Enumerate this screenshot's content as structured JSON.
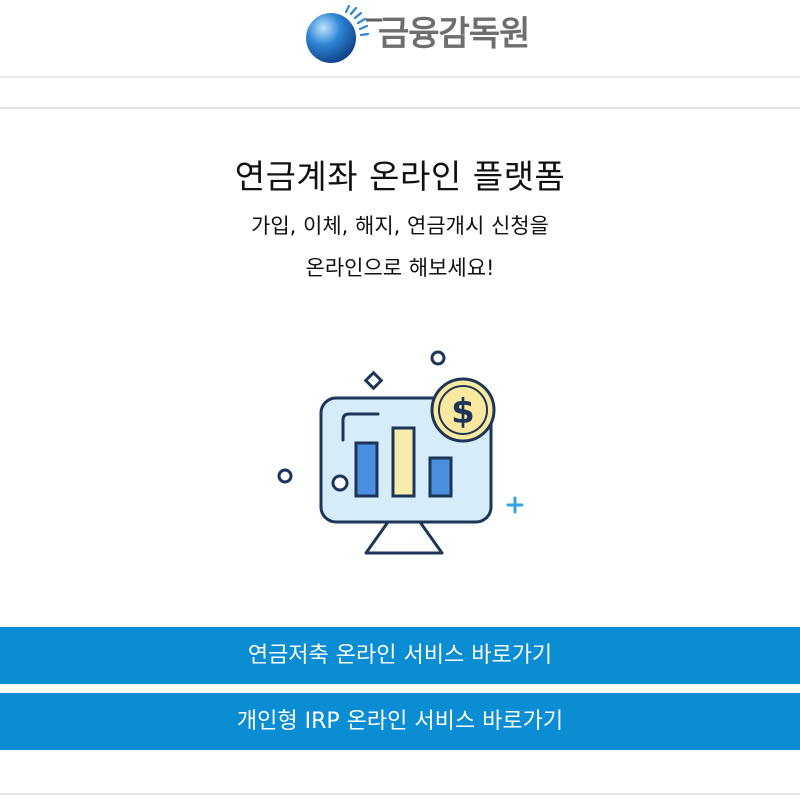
{
  "header": {
    "logo_text": "금융감독원",
    "logo_icon": "fss-globe-logo"
  },
  "hero": {
    "title": "연금계좌 온라인 플랫폼",
    "subtitle_line1": "가입, 이체, 해지, 연금개시 신청을",
    "subtitle_line2": "온라인으로 해보세요!",
    "illustration_icon": "monitor-bar-chart-dollar-icon",
    "dollar_symbol": "$"
  },
  "buttons": {
    "pension_savings_label": "연금저축 온라인 서비스 바로가기",
    "irp_label": "개인형 IRP 온라인 서비스 바로가기"
  },
  "colors": {
    "button_bg": "#0b8dd3",
    "button_text": "#ffffff",
    "logo_blue": "#1f6fbf",
    "logo_text": "#6e6e6e",
    "illustration_outline": "#1d3557",
    "illustration_screen": "#d6ecf8",
    "illustration_bar_blue": "#4a8fe0",
    "illustration_bar_yellow": "#f8ecaa",
    "coin_yellow": "#fbe9a0"
  }
}
